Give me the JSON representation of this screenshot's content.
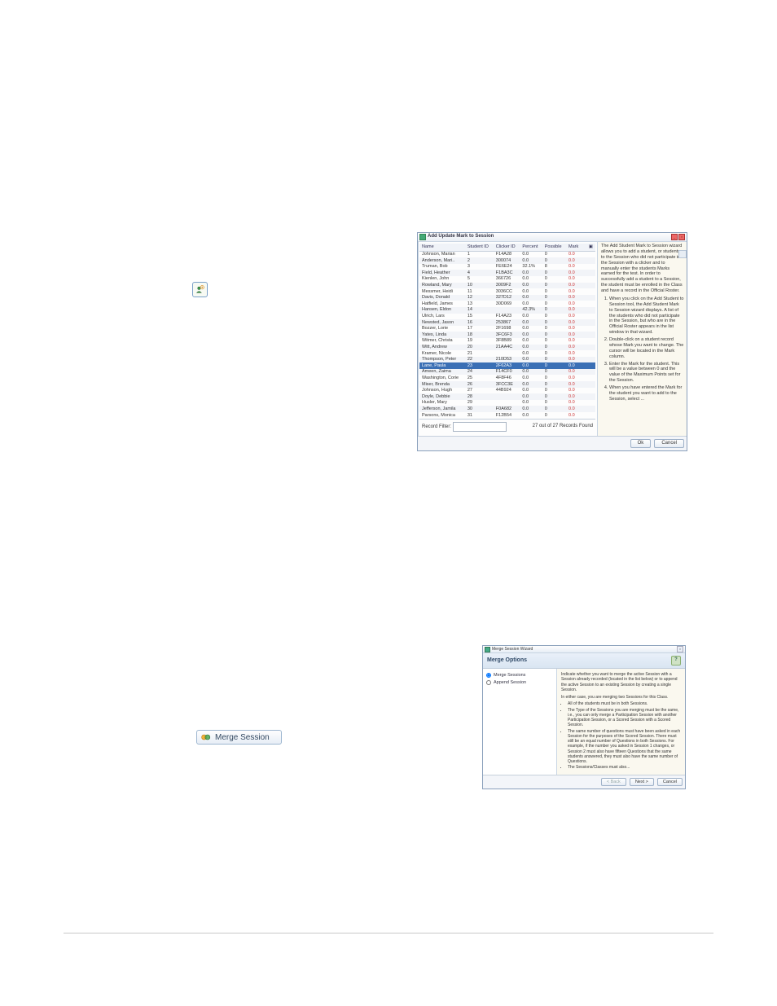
{
  "topIcon": {
    "name": "add-student-icon"
  },
  "dialog1": {
    "title": "Add Update Mark to Session",
    "columns": [
      "Name",
      "Student ID",
      "Clicker ID",
      "Percent",
      "Possible",
      "Mark"
    ],
    "cornerHeader": "",
    "rows": [
      {
        "name": "Johnson, Marian",
        "sid": "1",
        "cid": "F14A28",
        "pct": "0.0",
        "poss": "0",
        "mark": "0.0",
        "zebra": false
      },
      {
        "name": "Anderson, Mari..",
        "sid": "2",
        "cid": "300074",
        "pct": "0.0",
        "poss": "0",
        "mark": "0.0",
        "zebra": true
      },
      {
        "name": "Truman, Bob",
        "sid": "3",
        "cid": "FE6E24",
        "pct": "32.1%",
        "poss": "8",
        "mark": "0.0",
        "zebra": false
      },
      {
        "name": "Field, Heather",
        "sid": "4",
        "cid": "F1BA3C",
        "pct": "0.0",
        "poss": "0",
        "mark": "0.0",
        "zebra": true
      },
      {
        "name": "Kienlen, John",
        "sid": "5",
        "cid": "366726",
        "pct": "0.0",
        "poss": "0",
        "mark": "0.0",
        "zebra": false
      },
      {
        "name": "Rowland, Mary",
        "sid": "10",
        "cid": "3009F2",
        "pct": "0.0",
        "poss": "0",
        "mark": "0.0",
        "zebra": true
      },
      {
        "name": "Messmer, Heidi",
        "sid": "11",
        "cid": "3036CC",
        "pct": "0.0",
        "poss": "0",
        "mark": "0.0",
        "zebra": false
      },
      {
        "name": "Davis, Donald",
        "sid": "12",
        "cid": "327D12",
        "pct": "0.0",
        "poss": "0",
        "mark": "0.0",
        "zebra": true
      },
      {
        "name": "Hatfield, James",
        "sid": "13",
        "cid": "30D069",
        "pct": "0.0",
        "poss": "0",
        "mark": "0.0",
        "zebra": false
      },
      {
        "name": "Hansen, Eldon",
        "sid": "14",
        "cid": "",
        "pct": "42.3%",
        "poss": "0",
        "mark": "0.0",
        "zebra": true
      },
      {
        "name": "Ulrich, Lars",
        "sid": "15",
        "cid": "F14A23",
        "pct": "0.0",
        "poss": "0",
        "mark": "0.0",
        "zebra": false
      },
      {
        "name": "Newsted, Jason",
        "sid": "16",
        "cid": "253867",
        "pct": "0.0",
        "poss": "0",
        "mark": "0.0",
        "zebra": true
      },
      {
        "name": "Bozzer, Lorie",
        "sid": "17",
        "cid": "2F1698",
        "pct": "0.0",
        "poss": "0",
        "mark": "0.0",
        "zebra": false
      },
      {
        "name": "Yates, Linda",
        "sid": "18",
        "cid": "3FC6F3",
        "pct": "0.0",
        "poss": "0",
        "mark": "0.0",
        "zebra": true
      },
      {
        "name": "Witmer, Christa",
        "sid": "19",
        "cid": "3F8B89",
        "pct": "0.0",
        "poss": "0",
        "mark": "0.0",
        "zebra": false
      },
      {
        "name": "Witt, Andrew",
        "sid": "20",
        "cid": "21AA4C",
        "pct": "0.0",
        "poss": "0",
        "mark": "0.0",
        "zebra": true
      },
      {
        "name": "Kramer, Nicole",
        "sid": "21",
        "cid": "",
        "pct": "0.0",
        "poss": "0",
        "mark": "0.0",
        "zebra": false
      },
      {
        "name": "Thompson, Peter",
        "sid": "22",
        "cid": "210D53",
        "pct": "0.0",
        "poss": "0",
        "mark": "0.0",
        "zebra": true
      },
      {
        "name": "Lane, Paula",
        "sid": "23",
        "cid": "2F62A3",
        "pct": "0.0",
        "poss": "0",
        "mark": "0.0",
        "zebra": false,
        "selected": true
      },
      {
        "name": "Ameen, Zaima",
        "sid": "24",
        "cid": "F14CF0",
        "pct": "0.0",
        "poss": "0",
        "mark": "0.0",
        "zebra": true
      },
      {
        "name": "Washington, Corie",
        "sid": "25",
        "cid": "4F8F46",
        "pct": "0.0",
        "poss": "0",
        "mark": "0.0",
        "zebra": false
      },
      {
        "name": "Miser, Brenda",
        "sid": "26",
        "cid": "3FCC3E",
        "pct": "0.0",
        "poss": "0",
        "mark": "0.0",
        "zebra": true
      },
      {
        "name": "Johnson, Hugh",
        "sid": "27",
        "cid": "44B924",
        "pct": "0.0",
        "poss": "0",
        "mark": "0.0",
        "zebra": false
      },
      {
        "name": "Doyle, Debbie",
        "sid": "28",
        "cid": "",
        "pct": "0.0",
        "poss": "0",
        "mark": "0.0",
        "zebra": true
      },
      {
        "name": "Husler, Mary",
        "sid": "29",
        "cid": "",
        "pct": "0.0",
        "poss": "0",
        "mark": "0.0",
        "zebra": false
      },
      {
        "name": "Jefferson, Jamila",
        "sid": "30",
        "cid": "F0A682",
        "pct": "0.0",
        "poss": "0",
        "mark": "0.0",
        "zebra": true
      },
      {
        "name": "Parsons, Monica",
        "sid": "31",
        "cid": "F12B54",
        "pct": "0.0",
        "poss": "0",
        "mark": "0.0",
        "zebra": false
      }
    ],
    "recordFilterLabel": "Record Filter:",
    "recordFilterValue": "",
    "recordsFound": "27 out of 27 Records Found",
    "ok": "Ok",
    "cancel": "Cancel",
    "help": {
      "intro1": "The Add Student Mark to Session wizard allows you to add a student, or students, to the Session who did not participate in the Session with a clicker and to manually enter the students Marks earned for the test. In order to successfully add a student to a Session, the student must be enrolled in the Class and have a record in the Official Roster.",
      "step1a": "When you click on the Add Student to Session tool, the Add Student Mark to Session wizard displays. A list of the students who did not participate in the Session, but who are in the Official Roster appears in the list window in that wizard.",
      "step2": "Double-click on a student record whose Mark you want to change. The cursor will be located in the Mark column.",
      "step3": "Enter the Mark for the student. This will be a value between 0 and the value of the Maximum Points set for the Session.",
      "step4": "When you have entered the Mark for the student you want to add to the Session, select ..."
    }
  },
  "mergeChip": {
    "label": "Merge Session"
  },
  "mergeWizard": {
    "windowTitle": "Merge Session Wizard",
    "header": "Merge Options",
    "radio1": "Merge Sessions",
    "radio2": "Append Session",
    "closeX": "×",
    "helpGlyph": "?",
    "right": {
      "p1": "Indicate whether you want to merge the active Session with a Session already recorded (located in the list below) or to append the active Session to an existing Session by creating a single Session.",
      "p2": "In either case, you are merging two Sessions for this Class.",
      "b1": "All of the students must be in both Sessions.",
      "b2": "The Type of the Sessions you are merging must be the same, i.e., you can only merge a Participation Session with another Participation Session, or a Scored Session with a Scored Session.",
      "b3": "The same number of questions must have been asked in each Session for the purposes of the Scored Session. There must still be an equal number of Questions in both Sessions. For example, if the number you asked in Session 1 changes, or Session 2 must also have fifteen Questions that the same students answered, they must also have the same number of Questions.",
      "b4": "The Sessions/Classes must also...",
      "back": "< Back",
      "next": "Next >",
      "cancel": "Cancel"
    }
  }
}
